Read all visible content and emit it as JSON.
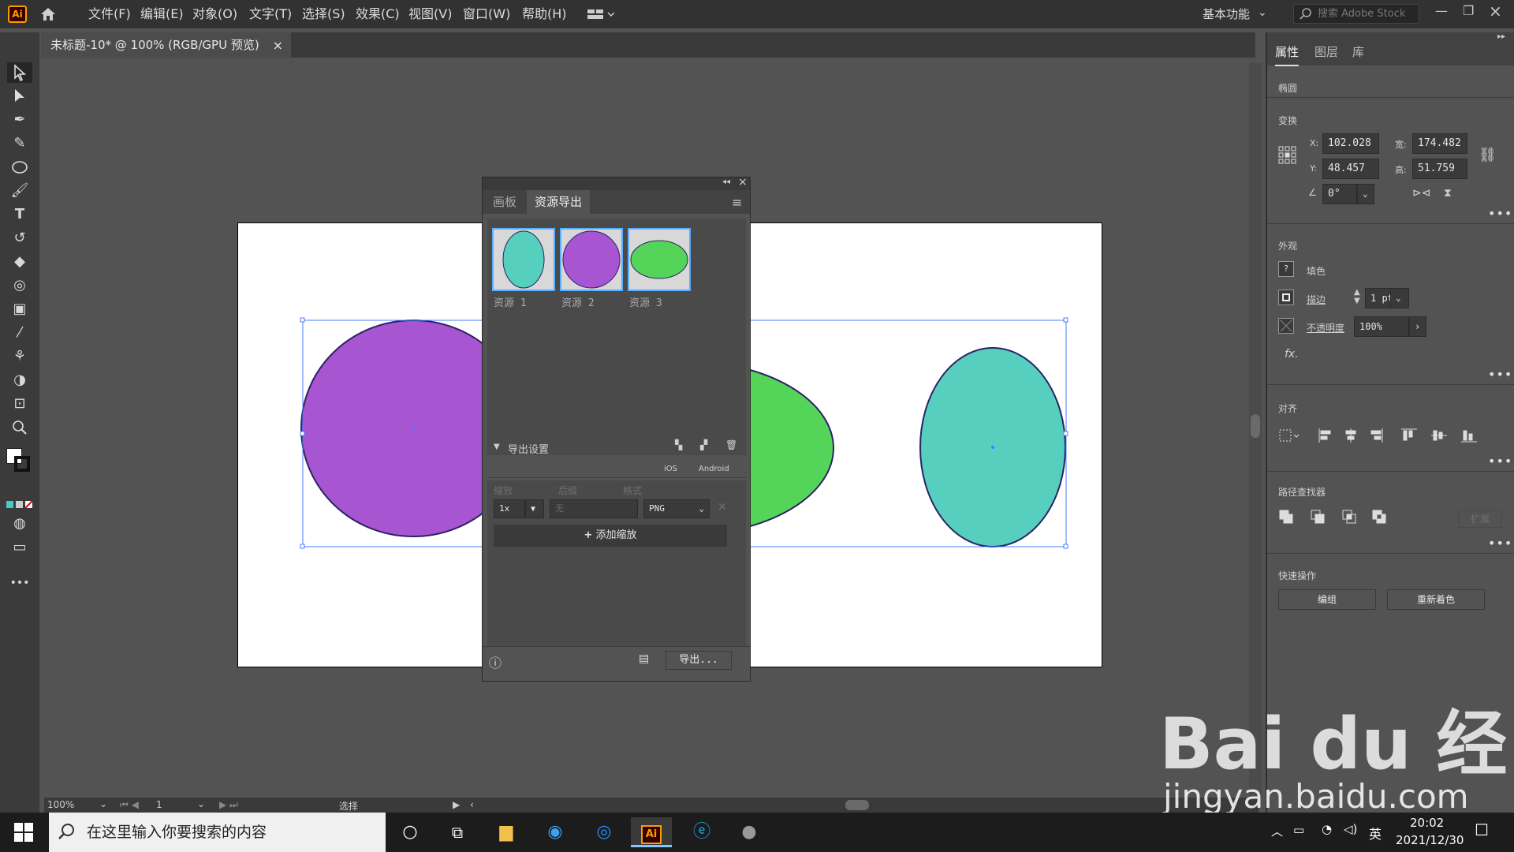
{
  "menubar": {
    "app_logo": "Ai",
    "items": [
      "文件(F)",
      "编辑(E)",
      "对象(O)",
      "文字(T)",
      "选择(S)",
      "效果(C)",
      "视图(V)",
      "窗口(W)",
      "帮助(H)"
    ],
    "workspace": "基本功能",
    "search_placeholder": "搜索 Adobe Stock"
  },
  "document": {
    "tab_title": "未标题-10* @ 100% (RGB/GPU 预览)",
    "close": "×"
  },
  "toolbar": {
    "icons": [
      "selection-tool",
      "direct-selection-tool",
      "pen-tool",
      "curvature-tool",
      "ellipse-tool",
      "paintbrush-tool",
      "type-tool",
      "rotate-tool",
      "eraser-tool",
      "shape-builder-tool",
      "gradient-tool",
      "eyedropper-tool",
      "puppet-warp-tool",
      "blend-tool",
      "artboard-tool",
      "zoom-tool"
    ],
    "more": "•••"
  },
  "statusbar": {
    "zoom": "100%",
    "artboard_num": "1",
    "mode": "选择"
  },
  "colors": {
    "purple": "#a855d1",
    "green": "#55d45a",
    "teal": "#56cfbe",
    "selection": "#4a7dff"
  },
  "asset_panel": {
    "tabs": [
      "画板",
      "资源导出"
    ],
    "assets": [
      {
        "label": "资源 1",
        "shape": "teal-ellipse"
      },
      {
        "label": "资源 2",
        "shape": "purple-circle"
      },
      {
        "label": "资源 3",
        "shape": "green-ellipse"
      }
    ],
    "export_settings_label": "导出设置",
    "platforms": [
      "iOS",
      "Android"
    ],
    "headers": {
      "scale": "缩放",
      "suffix": "后缀",
      "format": "格式"
    },
    "scale_value": "1x",
    "suffix_placeholder": "无",
    "format_value": "PNG",
    "add_scale": "添加缩放",
    "export_button": "导出..."
  },
  "properties_panel": {
    "tabs": [
      "属性",
      "图层",
      "库"
    ],
    "object_type": "椭圆",
    "transform_title": "变换",
    "x_label": "X:",
    "x_value": "102.028",
    "y_label": "Y:",
    "y_value": "48.457 ",
    "w_label": "宽:",
    "w_value": "174.482",
    "h_label": "高:",
    "h_value": "51.759 ",
    "angle_value": "0°",
    "appearance_title": "外观",
    "fill_label": "填色",
    "stroke_label": "描边",
    "stroke_value": "1 pt",
    "opacity_label": "不透明度",
    "opacity_value": "100%",
    "fx": "fx.",
    "align_title": "对齐",
    "pathfinder_title": "路径查找器",
    "expand_label": "扩展",
    "quick_actions_title": "快速操作",
    "group_button": "编组",
    "recolor_button": "重新着色",
    "more": "•••"
  },
  "taskbar": {
    "search_placeholder": "在这里输入你要搜索的内容",
    "ime": "英",
    "time": "20:02",
    "date": "2021/12/30"
  },
  "watermark": {
    "brand": "Bai du 经验",
    "url": "jingyan.baidu.com"
  }
}
